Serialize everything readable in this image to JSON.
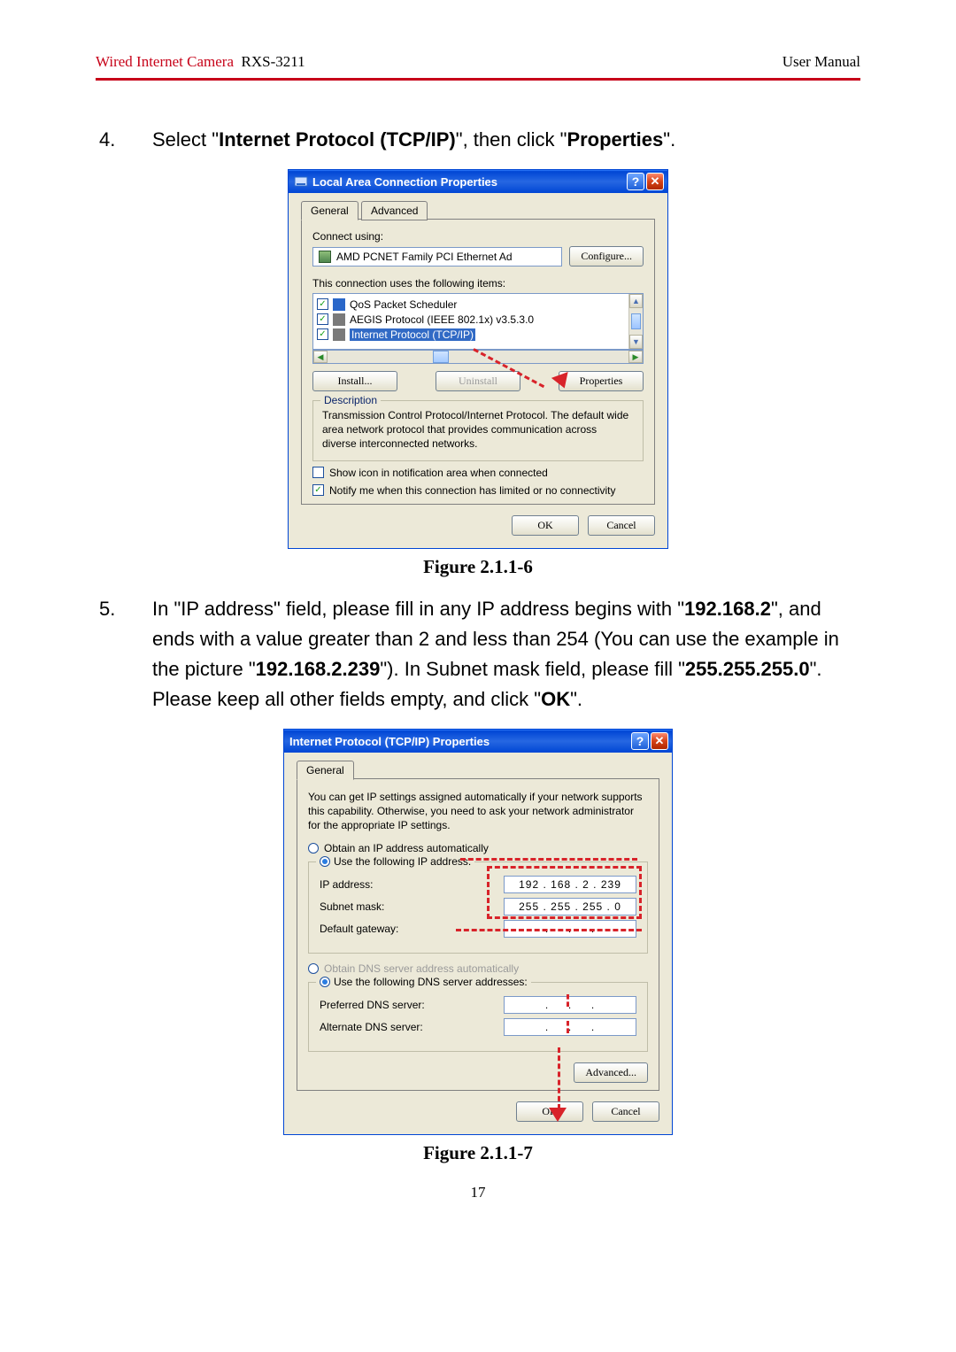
{
  "header": {
    "product": "Wired Internet Camera",
    "model": "RXS-3211",
    "right": "User Manual"
  },
  "step4": {
    "number": "4.",
    "text_pre": "Select \"",
    "bold1": "Internet Protocol (TCP/IP)",
    "text_mid": "\", then click \"",
    "bold2": "Properties",
    "text_post": "\"."
  },
  "dialog1": {
    "title": "Local Area Connection Properties",
    "tabs": {
      "general": "General",
      "advanced": "Advanced"
    },
    "connect_using": "Connect using:",
    "adapter": "AMD PCNET Family PCI Ethernet Ad",
    "configure": "Configure...",
    "uses_items": "This connection uses the following items:",
    "item_qos": "QoS Packet Scheduler",
    "item_aegis": "AEGIS Protocol (IEEE 802.1x) v3.5.3.0",
    "item_tcpip": "Internet Protocol (TCP/IP)",
    "install": "Install...",
    "uninstall": "Uninstall",
    "properties": "Properties",
    "desc_legend": "Description",
    "desc_text": "Transmission Control Protocol/Internet Protocol. The default wide area network protocol that provides communication across diverse interconnected networks.",
    "show_icon": "Show icon in notification area when connected",
    "notify": "Notify me when this connection has limited or no connectivity",
    "ok": "OK",
    "cancel": "Cancel"
  },
  "fig1": "Figure 2.1.1-6",
  "step5": {
    "number": "5.",
    "t1": "In \"IP address\" field, please fill in any IP address begins with \"",
    "b1": "192.168.2",
    "t2": "\", and ends with a value greater than 2 and less than 254 (You can use the example in the picture \"",
    "b2": "192.168.2.239",
    "t3": "\"). In Subnet mask field, please fill \"",
    "b3": "255.255.255.0",
    "t4": "\". Please keep all other fields empty, and click \"",
    "b4": "OK",
    "t5": "\"."
  },
  "dialog2": {
    "title": "Internet Protocol (TCP/IP) Properties",
    "tab": "General",
    "intro": "You can get IP settings assigned automatically if your network supports this capability. Otherwise, you need to ask your network administrator for the appropriate IP settings.",
    "r_auto_ip": "Obtain an IP address automatically",
    "r_use_ip": "Use the following IP address:",
    "ip_label": "IP address:",
    "ip_value": "192 . 168 .   2  . 239",
    "subnet_label": "Subnet mask:",
    "subnet_value": "255 . 255 . 255 .   0",
    "gw_label": "Default gateway:",
    "r_auto_dns": "Obtain DNS server address automatically",
    "r_use_dns": "Use the following DNS server addresses:",
    "pdns": "Preferred DNS server:",
    "adns": "Alternate DNS server:",
    "advanced": "Advanced...",
    "ok": "OK",
    "cancel": "Cancel"
  },
  "fig2": "Figure 2.1.1-7",
  "pagenum": "17"
}
